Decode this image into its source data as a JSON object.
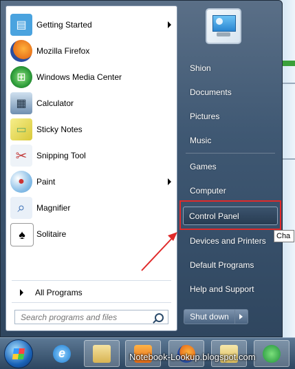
{
  "programs": [
    {
      "label": "Getting Started",
      "icon": "getting-started-icon",
      "submenu": true,
      "color": "#4aa3df"
    },
    {
      "label": "Mozilla Firefox",
      "icon": "firefox-icon",
      "submenu": false,
      "color": "#e8731c"
    },
    {
      "label": "Windows Media Center",
      "icon": "media-center-icon",
      "submenu": false,
      "color": "#2e9d3b"
    },
    {
      "label": "Calculator",
      "icon": "calculator-icon",
      "submenu": false,
      "color": "#6f8fb0"
    },
    {
      "label": "Sticky Notes",
      "icon": "sticky-notes-icon",
      "submenu": false,
      "color": "#e8d94a"
    },
    {
      "label": "Snipping Tool",
      "icon": "scissors-icon",
      "submenu": false,
      "color": "#c23b3b"
    },
    {
      "label": "Paint",
      "icon": "paint-icon",
      "submenu": true,
      "color": "#5aa0d8"
    },
    {
      "label": "Magnifier",
      "icon": "magnifier-icon",
      "submenu": false,
      "color": "#3a6fb5"
    },
    {
      "label": "Solitaire",
      "icon": "solitaire-icon",
      "submenu": false,
      "color": "#2f6b3b"
    }
  ],
  "all_programs": {
    "label": "All Programs"
  },
  "search": {
    "placeholder": "Search programs and files"
  },
  "right_links": [
    {
      "label": "Shion"
    },
    {
      "label": "Documents"
    },
    {
      "label": "Pictures"
    },
    {
      "label": "Music"
    },
    {
      "label": "Games"
    },
    {
      "label": "Computer"
    },
    {
      "label": "Control Panel",
      "selected": true
    },
    {
      "label": "Devices and Printers"
    },
    {
      "label": "Default Programs"
    },
    {
      "label": "Help and Support"
    }
  ],
  "shutdown": {
    "label": "Shut down"
  },
  "tooltip": {
    "text": "Cha"
  },
  "taskbar": {
    "items": [
      "internet-explorer-icon",
      "explorer-folder-icon",
      "media-player-icon",
      "firefox-icon",
      "folder-icon",
      "download-manager-icon"
    ]
  },
  "watermark": {
    "text": "Notebook-Lookup.blogspot.com"
  },
  "colors": {
    "highlight": "#e02a2a",
    "pane_bg": "#ffffff"
  }
}
